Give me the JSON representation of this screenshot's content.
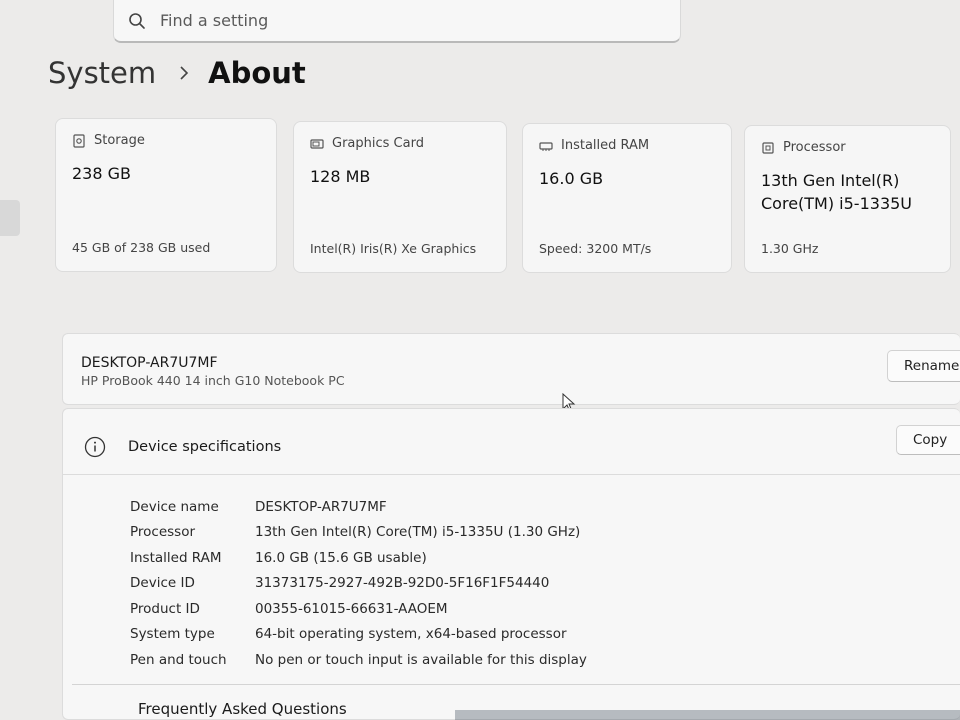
{
  "search": {
    "placeholder": "Find a setting"
  },
  "breadcrumb": {
    "root": "System",
    "current": "About"
  },
  "cards": [
    {
      "icon": "storage-icon",
      "label": "Storage",
      "value": "238 GB",
      "sub": "45 GB of 238 GB used"
    },
    {
      "icon": "graphics-card-icon",
      "label": "Graphics Card",
      "value": "128 MB",
      "sub": "Intel(R) Iris(R) Xe Graphics"
    },
    {
      "icon": "ram-icon",
      "label": "Installed RAM",
      "value": "16.0 GB",
      "sub": "Speed: 3200 MT/s"
    },
    {
      "icon": "processor-icon",
      "label": "Processor",
      "value_line1": "13th Gen Intel(R)",
      "value_line2": "Core(TM) i5-1335U",
      "sub": "1.30 GHz"
    }
  ],
  "device": {
    "name": "DESKTOP-AR7U7MF",
    "model": "HP ProBook 440 14 inch G10 Notebook PC",
    "rename_label": "Rename"
  },
  "specs": {
    "title": "Device specifications",
    "copy_label": "Copy",
    "rows": [
      {
        "key": "Device name",
        "value": "DESKTOP-AR7U7MF"
      },
      {
        "key": "Processor",
        "value": "13th Gen Intel(R) Core(TM) i5-1335U (1.30 GHz)"
      },
      {
        "key": "Installed RAM",
        "value": "16.0 GB (15.6 GB usable)"
      },
      {
        "key": "Device ID",
        "value": "31373175-2927-492B-92D0-5F16F1F54440"
      },
      {
        "key": "Product ID",
        "value": "00355-61015-66631-AAOEM"
      },
      {
        "key": "System type",
        "value": "64-bit operating system, x64-based processor"
      },
      {
        "key": "Pen and touch",
        "value": "No pen or touch input is available for this display"
      }
    ]
  },
  "faq": {
    "title": "Frequently Asked Questions"
  }
}
